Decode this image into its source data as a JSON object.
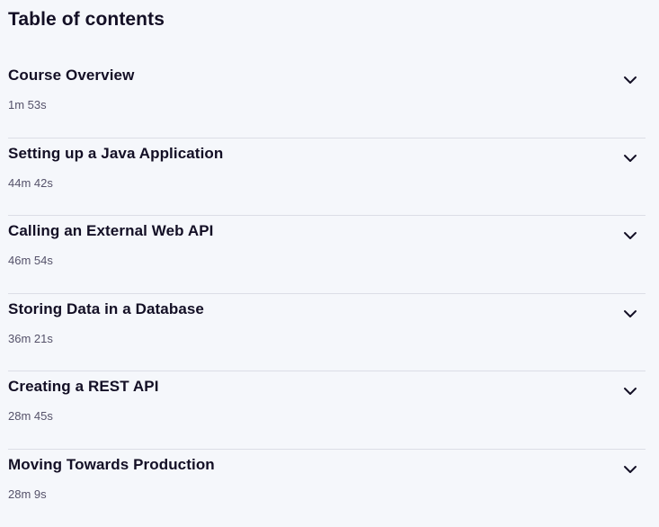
{
  "toc": {
    "title": "Table of contents",
    "modules": [
      {
        "title": "Course Overview",
        "duration": "1m 53s",
        "icon": "chevron-down-icon"
      },
      {
        "title": "Setting up a Java Application",
        "duration": "44m 42s",
        "icon": "chevron-down-icon"
      },
      {
        "title": "Calling an External Web API",
        "duration": "46m 54s",
        "icon": "chevron-down-icon"
      },
      {
        "title": "Storing Data in a Database",
        "duration": "36m 21s",
        "icon": "chevron-down-icon"
      },
      {
        "title": "Creating a REST API",
        "duration": "28m 45s",
        "icon": "chevron-down-icon"
      },
      {
        "title": "Moving Towards Production",
        "duration": "28m 9s",
        "icon": "chevron-down-icon"
      }
    ]
  },
  "colors": {
    "background": "#f5f7fb",
    "text": "#130f25",
    "muted_text": "#55526a",
    "divider": "#dcdee6"
  }
}
